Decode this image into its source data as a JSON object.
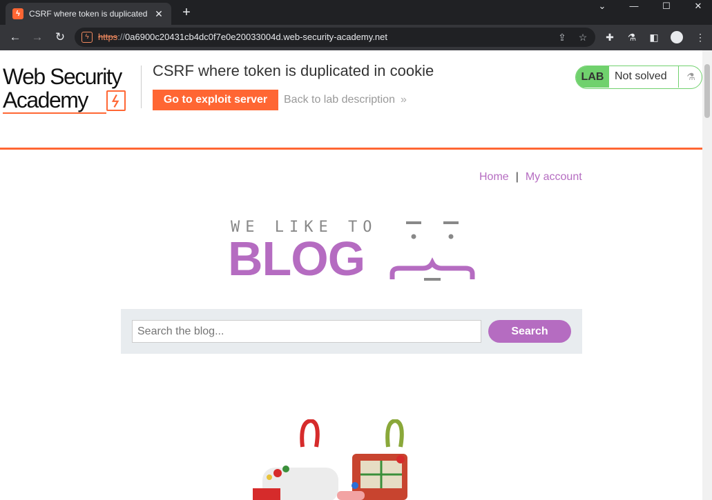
{
  "browser": {
    "tab_title": "CSRF where token is duplicated in cookie",
    "tab_favicon": "burp-lightning-icon",
    "new_tab_label": "+",
    "url_scheme": "https",
    "url_sep": "://",
    "url_host": "0a6900c20431cb4dc0f7e0e20033004d.web-security-academy.net"
  },
  "header": {
    "logo_line1": "Web Security",
    "logo_line2": "Academy",
    "lab_title": "CSRF where token is duplicated in cookie",
    "exploit_button": "Go to exploit server",
    "back_link": "Back to lab description",
    "back_chevron": "»",
    "lab_badge": "LAB",
    "lab_status": "Not solved",
    "accent_color": "#ff6633",
    "status_color": "#70d16d"
  },
  "nav": {
    "home": "Home",
    "separator": "|",
    "my_account": "My account"
  },
  "blog_logo": {
    "small_text": "WE LIKE TO",
    "big_text": "BLOG",
    "brand_color": "#b56cc1"
  },
  "search": {
    "placeholder": "Search the blog...",
    "button": "Search"
  }
}
